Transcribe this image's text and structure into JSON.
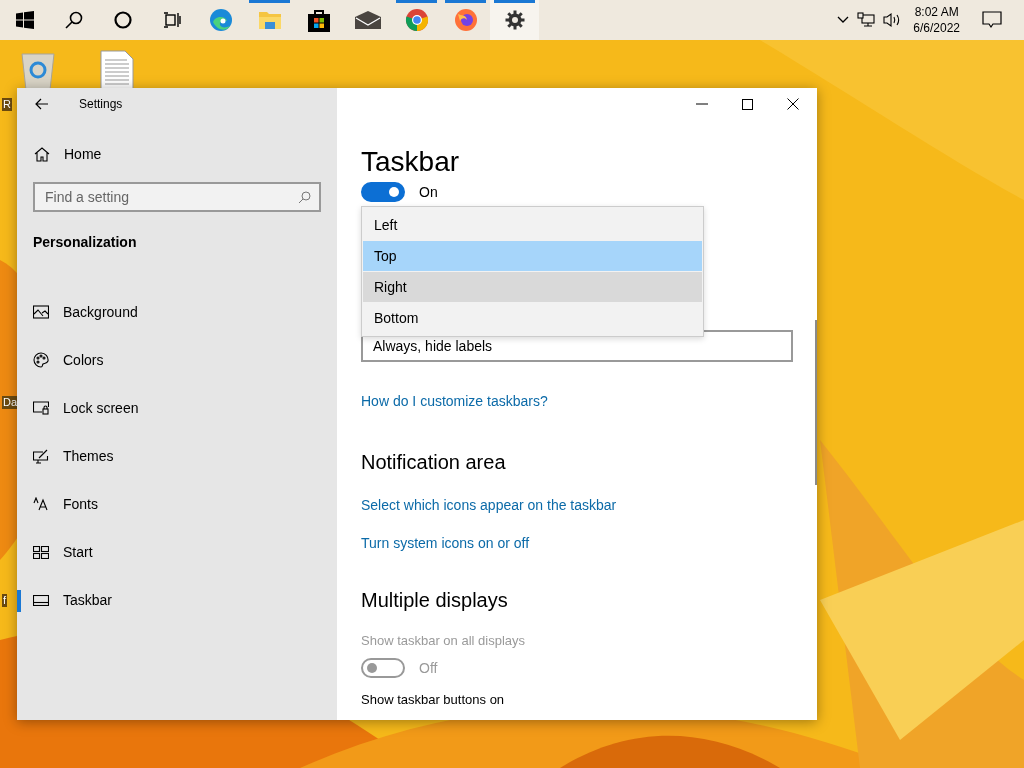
{
  "taskbar": {
    "apps": [
      {
        "kind": "start",
        "running": false,
        "selected": false
      },
      {
        "kind": "search",
        "running": false,
        "selected": false
      },
      {
        "kind": "cortana",
        "running": false,
        "selected": false
      },
      {
        "kind": "taskview",
        "running": false,
        "selected": false
      },
      {
        "kind": "edge",
        "running": false,
        "selected": false
      },
      {
        "kind": "explorer",
        "running": true,
        "selected": false
      },
      {
        "kind": "store",
        "running": false,
        "selected": false
      },
      {
        "kind": "mail",
        "running": false,
        "selected": false
      },
      {
        "kind": "chrome",
        "running": true,
        "selected": false
      },
      {
        "kind": "firefox",
        "running": true,
        "selected": false
      },
      {
        "kind": "settings",
        "running": true,
        "selected": true
      }
    ],
    "tray": {
      "time": "8:02 AM",
      "date": "6/6/2022"
    }
  },
  "desktop": {
    "label_fragments": [
      "R",
      "Da",
      "f"
    ]
  },
  "window": {
    "title": "Settings",
    "sidebar": {
      "home": "Home",
      "search": {
        "placeholder": "Find a setting"
      },
      "section": "Personalization",
      "items": [
        {
          "kind": "background",
          "label": "Background",
          "selected": false
        },
        {
          "kind": "colors",
          "label": "Colors",
          "selected": false
        },
        {
          "kind": "lock",
          "label": "Lock screen",
          "selected": false
        },
        {
          "kind": "themes",
          "label": "Themes",
          "selected": false
        },
        {
          "kind": "fonts",
          "label": "Fonts",
          "selected": false
        },
        {
          "kind": "start",
          "label": "Start",
          "selected": false
        },
        {
          "kind": "taskbar",
          "label": "Taskbar",
          "selected": true
        }
      ]
    },
    "content": {
      "heading": "Taskbar",
      "toggle": {
        "on": true,
        "label": "On"
      },
      "combo": {
        "value": "Always, hide labels"
      },
      "dropdown": [
        {
          "label": "Left",
          "selected": false,
          "hovered": false
        },
        {
          "label": "Top",
          "selected": true,
          "hovered": false
        },
        {
          "label": "Right",
          "selected": false,
          "hovered": true
        },
        {
          "label": "Bottom",
          "selected": false,
          "hovered": false
        }
      ],
      "help_link": "How do I customize taskbars?",
      "notification_area": {
        "heading": "Notification area",
        "links": [
          "Select which icons appear on the taskbar",
          "Turn system icons on or off"
        ]
      },
      "multiple_displays": {
        "heading": "Multiple displays",
        "setting": {
          "label": "Show taskbar on all displays",
          "disabled": true,
          "toggle": {
            "on": false,
            "label": "Off"
          }
        },
        "next_label": "Show taskbar buttons on"
      }
    }
  }
}
